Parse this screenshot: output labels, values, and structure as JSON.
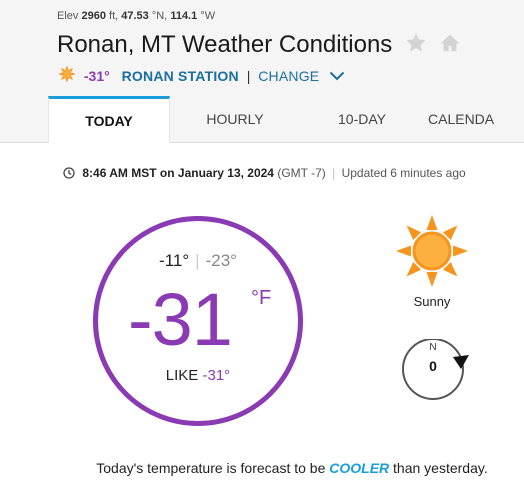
{
  "header": {
    "elev_label": "Elev",
    "elevation": "2960",
    "elev_unit": "ft,",
    "latitude": "47.53",
    "lat_suffix": "°N,",
    "longitude": "114.1",
    "lon_suffix": "°W",
    "title": "Ronan, MT Weather Conditions",
    "mini_temp": "-31°",
    "station": "RONAN STATION",
    "separator": "|",
    "change": "CHANGE"
  },
  "tabs": [
    {
      "label": "TODAY",
      "active": true
    },
    {
      "label": "HOURLY",
      "active": false
    },
    {
      "label": "10-DAY",
      "active": false
    },
    {
      "label": "CALENDA",
      "active": false
    }
  ],
  "observation": {
    "time": "8:46 AM MST on January 13, 2024",
    "gmt": "(GMT -7)",
    "pipe": "|",
    "updated": "Updated 6 minutes ago"
  },
  "current": {
    "high": "-11°",
    "divider": "|",
    "low": "-23°",
    "temp": "-31",
    "unit": "°F",
    "like_label": "LIKE",
    "like_value": "-31°",
    "condition": "Sunny",
    "wind_dir": "N",
    "wind_speed": "0"
  },
  "forecast": {
    "prefix": "Today's temperature is forecast to be",
    "word": "COOLER",
    "suffix": "than yesterday."
  },
  "colors": {
    "accent_purple": "#8a3bb3",
    "link_blue": "#1a6f9e",
    "tab_blue": "#1a9ed9",
    "sun_orange": "#f7941d"
  }
}
